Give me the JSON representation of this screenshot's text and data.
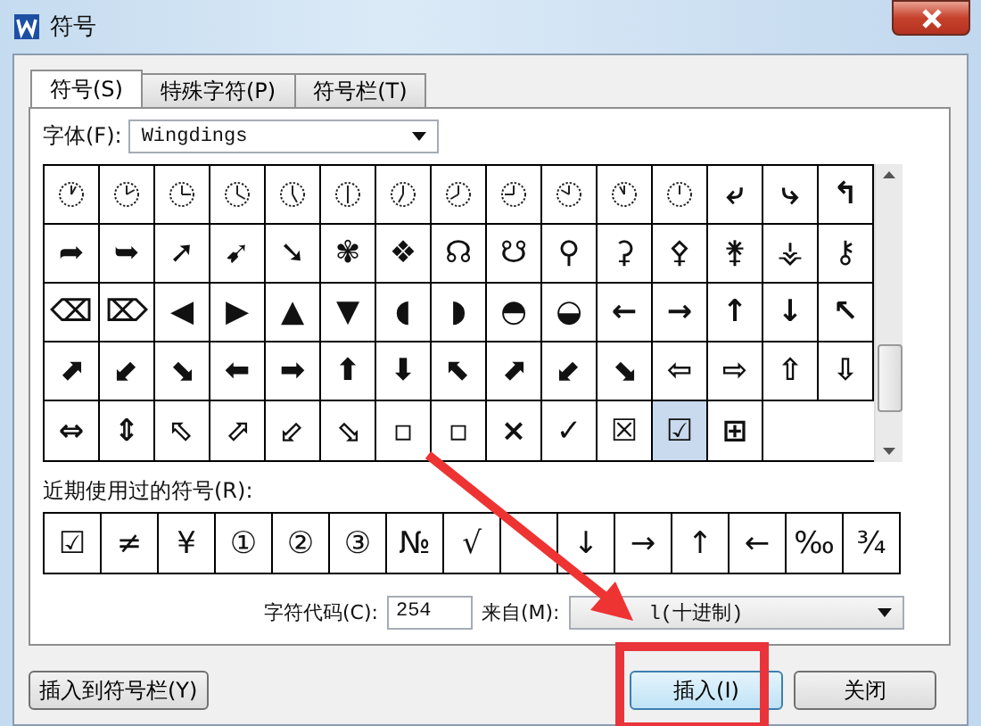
{
  "window": {
    "title": "符号"
  },
  "tabs": [
    {
      "label": "符号(S)",
      "selected": true
    },
    {
      "label": "特殊字符(P)",
      "selected": false
    },
    {
      "label": "符号栏(T)",
      "selected": false
    }
  ],
  "font": {
    "label": "字体(F):",
    "value": "Wingdings"
  },
  "grid": [
    {
      "kind": "clock",
      "selected": false
    },
    {
      "kind": "clock",
      "selected": false
    },
    {
      "kind": "clock",
      "selected": false
    },
    {
      "kind": "clock",
      "selected": false
    },
    {
      "kind": "clock",
      "selected": false
    },
    {
      "kind": "clock",
      "selected": false
    },
    {
      "kind": "clock",
      "selected": false
    },
    {
      "kind": "clock",
      "selected": false
    },
    {
      "kind": "clock",
      "selected": false
    },
    {
      "kind": "clock",
      "selected": false
    },
    {
      "kind": "clock",
      "selected": false
    },
    {
      "kind": "clock",
      "selected": false
    },
    {
      "kind": "glyph",
      "symbol": "⤶",
      "selected": false
    },
    {
      "kind": "glyph",
      "symbol": "⤷",
      "selected": false
    },
    {
      "kind": "glyph",
      "symbol": "↰",
      "selected": false
    },
    {
      "kind": "glyph",
      "symbol": "➦",
      "selected": false
    },
    {
      "kind": "glyph",
      "symbol": "➥",
      "selected": false
    },
    {
      "kind": "glyph",
      "symbol": "➚",
      "selected": false
    },
    {
      "kind": "glyph",
      "symbol": "➹",
      "selected": false
    },
    {
      "kind": "glyph",
      "symbol": "➘",
      "selected": false
    },
    {
      "kind": "glyph",
      "symbol": "✾",
      "selected": false
    },
    {
      "kind": "glyph",
      "symbol": "❖",
      "selected": false
    },
    {
      "kind": "glyph",
      "symbol": "☊",
      "selected": false
    },
    {
      "kind": "glyph",
      "symbol": "☋",
      "selected": false
    },
    {
      "kind": "glyph",
      "symbol": "⚲",
      "selected": false
    },
    {
      "kind": "glyph",
      "symbol": "⚳",
      "selected": false
    },
    {
      "kind": "glyph",
      "symbol": "⚴",
      "selected": false
    },
    {
      "kind": "glyph",
      "symbol": "⚵",
      "selected": false
    },
    {
      "kind": "glyph",
      "symbol": "⚶",
      "selected": false
    },
    {
      "kind": "glyph",
      "symbol": "⚷",
      "selected": false
    },
    {
      "kind": "glyph",
      "symbol": "⌫",
      "selected": false
    },
    {
      "kind": "glyph",
      "symbol": "⌦",
      "selected": false
    },
    {
      "kind": "glyph",
      "symbol": "◀",
      "selected": false
    },
    {
      "kind": "glyph",
      "symbol": "▶",
      "selected": false
    },
    {
      "kind": "glyph",
      "symbol": "▲",
      "selected": false
    },
    {
      "kind": "glyph",
      "symbol": "▼",
      "selected": false
    },
    {
      "kind": "glyph",
      "symbol": "◖",
      "selected": false
    },
    {
      "kind": "glyph",
      "symbol": "◗",
      "selected": false
    },
    {
      "kind": "glyph",
      "symbol": "◓",
      "selected": false
    },
    {
      "kind": "glyph",
      "symbol": "◒",
      "selected": false
    },
    {
      "kind": "glyph",
      "symbol": "←",
      "selected": false
    },
    {
      "kind": "glyph",
      "symbol": "→",
      "selected": false
    },
    {
      "kind": "glyph",
      "symbol": "↑",
      "selected": false
    },
    {
      "kind": "glyph",
      "symbol": "↓",
      "selected": false
    },
    {
      "kind": "glyph",
      "symbol": "↖",
      "selected": false
    },
    {
      "kind": "glyph",
      "symbol": "⬈",
      "selected": false
    },
    {
      "kind": "glyph",
      "symbol": "⬋",
      "selected": false
    },
    {
      "kind": "glyph",
      "symbol": "⬊",
      "selected": false
    },
    {
      "kind": "glyph",
      "symbol": "⬅",
      "selected": false
    },
    {
      "kind": "glyph",
      "symbol": "➡",
      "selected": false
    },
    {
      "kind": "glyph",
      "symbol": "⬆",
      "selected": false
    },
    {
      "kind": "glyph",
      "symbol": "⬇",
      "selected": false
    },
    {
      "kind": "glyph",
      "symbol": "⬉",
      "selected": false
    },
    {
      "kind": "glyph",
      "symbol": "⬈",
      "selected": false
    },
    {
      "kind": "glyph",
      "symbol": "⬋",
      "selected": false
    },
    {
      "kind": "glyph",
      "symbol": "⬊",
      "selected": false
    },
    {
      "kind": "glyph",
      "symbol": "⇦",
      "selected": false
    },
    {
      "kind": "glyph",
      "symbol": "⇨",
      "selected": false
    },
    {
      "kind": "glyph",
      "symbol": "⇧",
      "selected": false
    },
    {
      "kind": "glyph",
      "symbol": "⇩",
      "selected": false
    },
    {
      "kind": "glyph",
      "symbol": "⇔",
      "selected": false
    },
    {
      "kind": "glyph",
      "symbol": "⇕",
      "selected": false
    },
    {
      "kind": "glyph",
      "symbol": "⬁",
      "selected": false
    },
    {
      "kind": "glyph",
      "symbol": "⬀",
      "selected": false
    },
    {
      "kind": "glyph",
      "symbol": "⬃",
      "selected": false
    },
    {
      "kind": "glyph",
      "symbol": "⬂",
      "selected": false
    },
    {
      "kind": "glyph",
      "symbol": "▫",
      "selected": false
    },
    {
      "kind": "glyph",
      "symbol": "▫",
      "selected": false
    },
    {
      "kind": "glyph",
      "symbol": "×",
      "selected": false
    },
    {
      "kind": "glyph",
      "symbol": "✓",
      "selected": false
    },
    {
      "kind": "glyph",
      "symbol": "☒",
      "selected": false
    },
    {
      "kind": "glyph",
      "symbol": "☑",
      "selected": true
    },
    {
      "kind": "glyph",
      "symbol": "⊞",
      "selected": false
    }
  ],
  "recent": {
    "label": "近期使用过的符号(R):",
    "symbols": [
      {
        "kind": "glyph",
        "symbol": "☑"
      },
      {
        "kind": "glyph",
        "symbol": "≠"
      },
      {
        "kind": "glyph",
        "symbol": "¥"
      },
      {
        "kind": "glyph",
        "symbol": "①"
      },
      {
        "kind": "glyph",
        "symbol": "②"
      },
      {
        "kind": "glyph",
        "symbol": "③"
      },
      {
        "kind": "glyph",
        "symbol": "№"
      },
      {
        "kind": "glyph",
        "symbol": "√"
      },
      {
        "kind": "covered"
      },
      {
        "kind": "glyph",
        "symbol": "↓"
      },
      {
        "kind": "glyph",
        "symbol": "→"
      },
      {
        "kind": "glyph",
        "symbol": "↑"
      },
      {
        "kind": "glyph",
        "symbol": "←"
      },
      {
        "kind": "glyph",
        "symbol": "‰"
      },
      {
        "kind": "glyph",
        "symbol": "¾"
      }
    ]
  },
  "code": {
    "label": "字符代码(C):",
    "value": "254",
    "from_label": "来自(M):",
    "from_value": "l(十进制)"
  },
  "buttons": {
    "add_to_bar": "插入到符号栏(Y)",
    "insert": "插入(I)",
    "close": "关闭"
  }
}
